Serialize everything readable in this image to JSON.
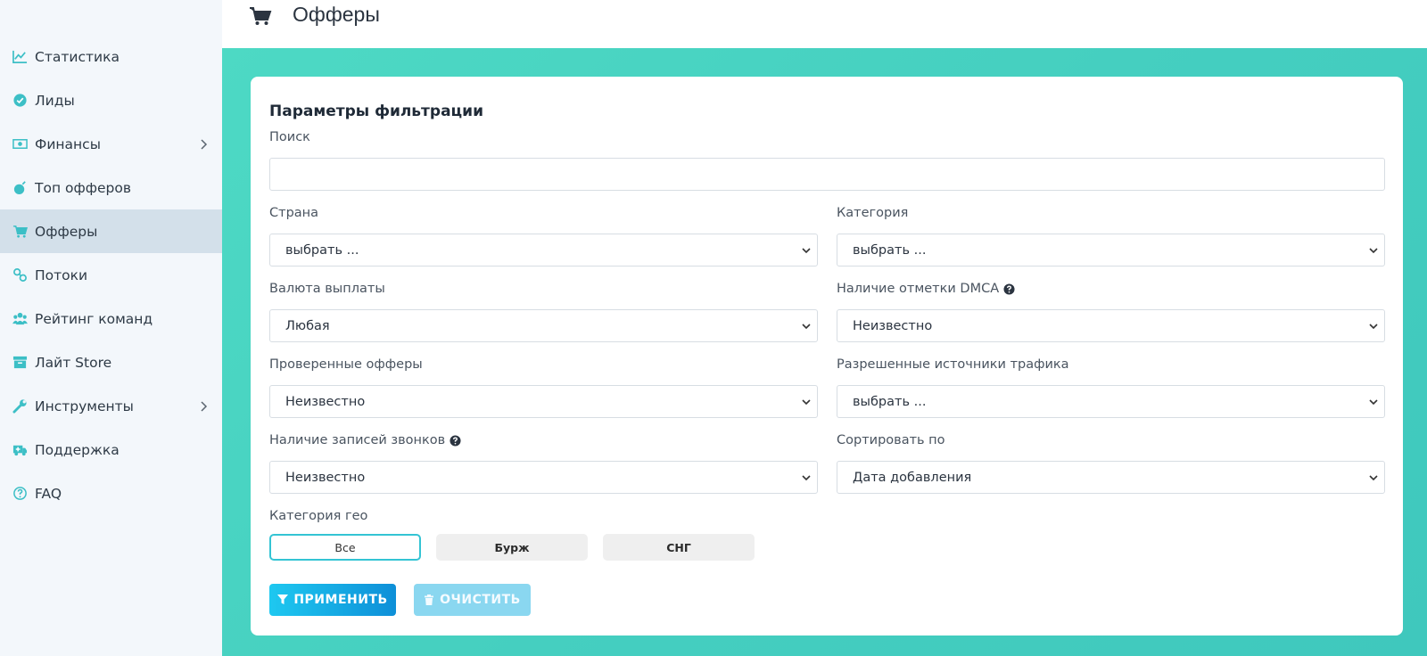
{
  "header": {
    "title": "Офферы",
    "icon": "cart-icon"
  },
  "sidebar": {
    "accent": "#3cbfc6",
    "items": [
      {
        "label": "Статистика",
        "icon": "chart-line-icon"
      },
      {
        "label": "Лиды",
        "icon": "check-circle-icon"
      },
      {
        "label": "Финансы",
        "icon": "money-icon",
        "expandable": true
      },
      {
        "label": "Топ офферов",
        "icon": "bomb-icon"
      },
      {
        "label": "Офферы",
        "icon": "cart-icon",
        "active": true
      },
      {
        "label": "Потоки",
        "icon": "link-icon"
      },
      {
        "label": "Рейтинг команд",
        "icon": "users-icon"
      },
      {
        "label": "Лайт Store",
        "icon": "archive-icon"
      },
      {
        "label": "Инструменты",
        "icon": "wrench-icon",
        "expandable": true
      },
      {
        "label": "Поддержка",
        "icon": "ambulance-icon"
      },
      {
        "label": "FAQ",
        "icon": "question-circle-icon"
      }
    ]
  },
  "filters": {
    "title": "Параметры фильтрации",
    "search": {
      "label": "Поиск",
      "value": "",
      "placeholder": ""
    },
    "country": {
      "label": "Страна",
      "value": "выбрать ..."
    },
    "category": {
      "label": "Категория",
      "value": "выбрать ..."
    },
    "currency": {
      "label": "Валюта выплаты",
      "value": "Любая"
    },
    "dmca": {
      "label": "Наличие отметки DMCA",
      "value": "Неизвестно"
    },
    "verified": {
      "label": "Проверенные офферы",
      "value": "Неизвестно"
    },
    "traffic": {
      "label": "Разрешенные источники трафика",
      "value": "выбрать ..."
    },
    "calls": {
      "label": "Наличие записей звонков",
      "value": "Неизвестно"
    },
    "sort": {
      "label": "Сортировать по",
      "value": "Дата добавления"
    },
    "geo": {
      "label": "Категория гео",
      "options": [
        "Все",
        "Бурж",
        "СНГ"
      ],
      "selected": "Все"
    },
    "apply_label": "ПРИМЕНИТЬ",
    "clear_label": "ОЧИСТИТЬ"
  }
}
